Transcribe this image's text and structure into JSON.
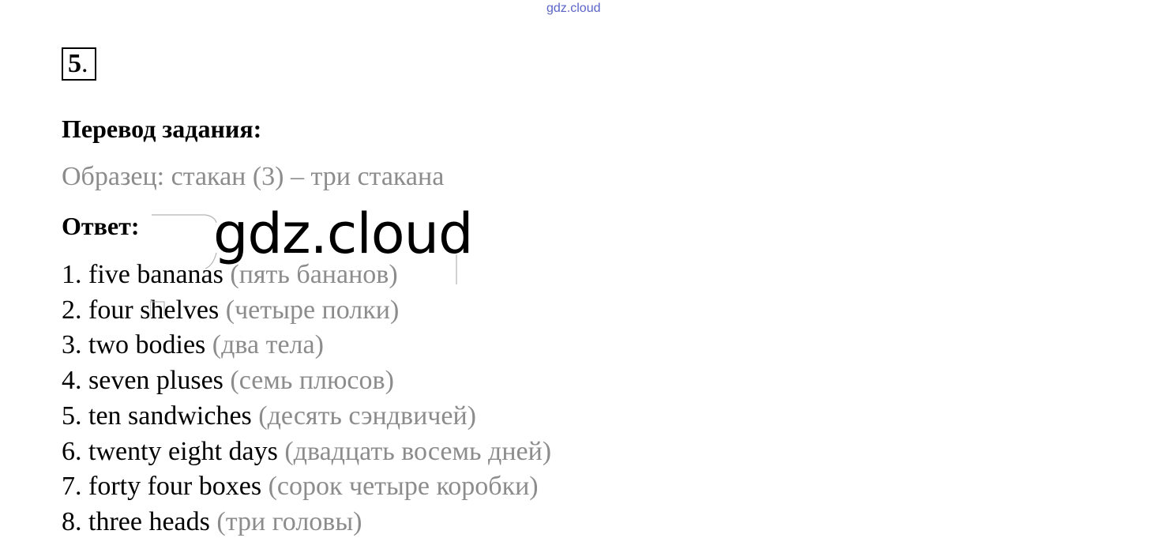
{
  "watermark_top": "gdz.cloud",
  "watermark_center": "gdz.cloud",
  "task": {
    "number": "5",
    "number_suffix": "."
  },
  "translation_heading": "Перевод задания:",
  "sample": "Образец: стакан (3) – три стакана",
  "answer_heading": "Ответ:",
  "answers": [
    {
      "en": "1. five bananas",
      "ru": "(пять бананов)"
    },
    {
      "en": "2. four shelves",
      "ru": "(четыре полки)"
    },
    {
      "en": "3. two bodies",
      "ru": "(два тела)"
    },
    {
      "en": "4. seven pluses",
      "ru": "(семь плюсов)"
    },
    {
      "en": "5. ten sandwiches",
      "ru": "(десять сэндвичей)"
    },
    {
      "en": "6. twenty eight days",
      "ru": "(двадцать восемь дней)"
    },
    {
      "en": "7. forty four boxes",
      "ru": "(сорок четыре коробки)"
    },
    {
      "en": "8. three heads",
      "ru": "(три головы)"
    }
  ],
  "colors": {
    "text": "#000000",
    "translation_gray": "#8c8c8c",
    "watermark_blue": "#5a64c8"
  }
}
